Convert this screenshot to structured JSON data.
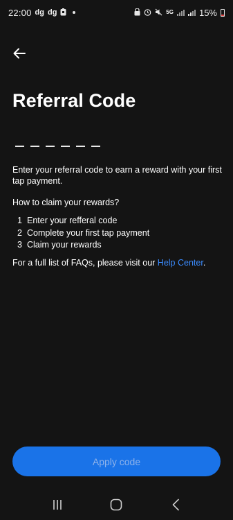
{
  "status_bar": {
    "time": "22:00",
    "notif_1": "dg",
    "notif_2": "dg",
    "network": "5G",
    "battery_percent": "15%",
    "battery_low_color": "#e04545"
  },
  "header": {
    "back_icon": "arrow-left-icon",
    "title": "Referral Code"
  },
  "code_input": {
    "length": 6
  },
  "content": {
    "description": "Enter your referral code to earn a reward with your first tap payment.",
    "howto_heading": "How to claim your rewards?",
    "steps": [
      {
        "num": "1",
        "text": "Enter your refferal code"
      },
      {
        "num": "2",
        "text": "Complete your first tap payment"
      },
      {
        "num": "3",
        "text": "Claim your rewards"
      }
    ],
    "faq_prefix": "For a full list of FAQs, please visit our ",
    "help_link": "Help Center",
    "faq_suffix": ".",
    "link_color": "#3b8cff"
  },
  "apply_button": {
    "label": "Apply code",
    "color": "#1a73e8"
  },
  "nav_bar": {
    "recents_icon": "recents-icon",
    "home_icon": "home-icon",
    "back_icon": "back-chevron-icon"
  }
}
